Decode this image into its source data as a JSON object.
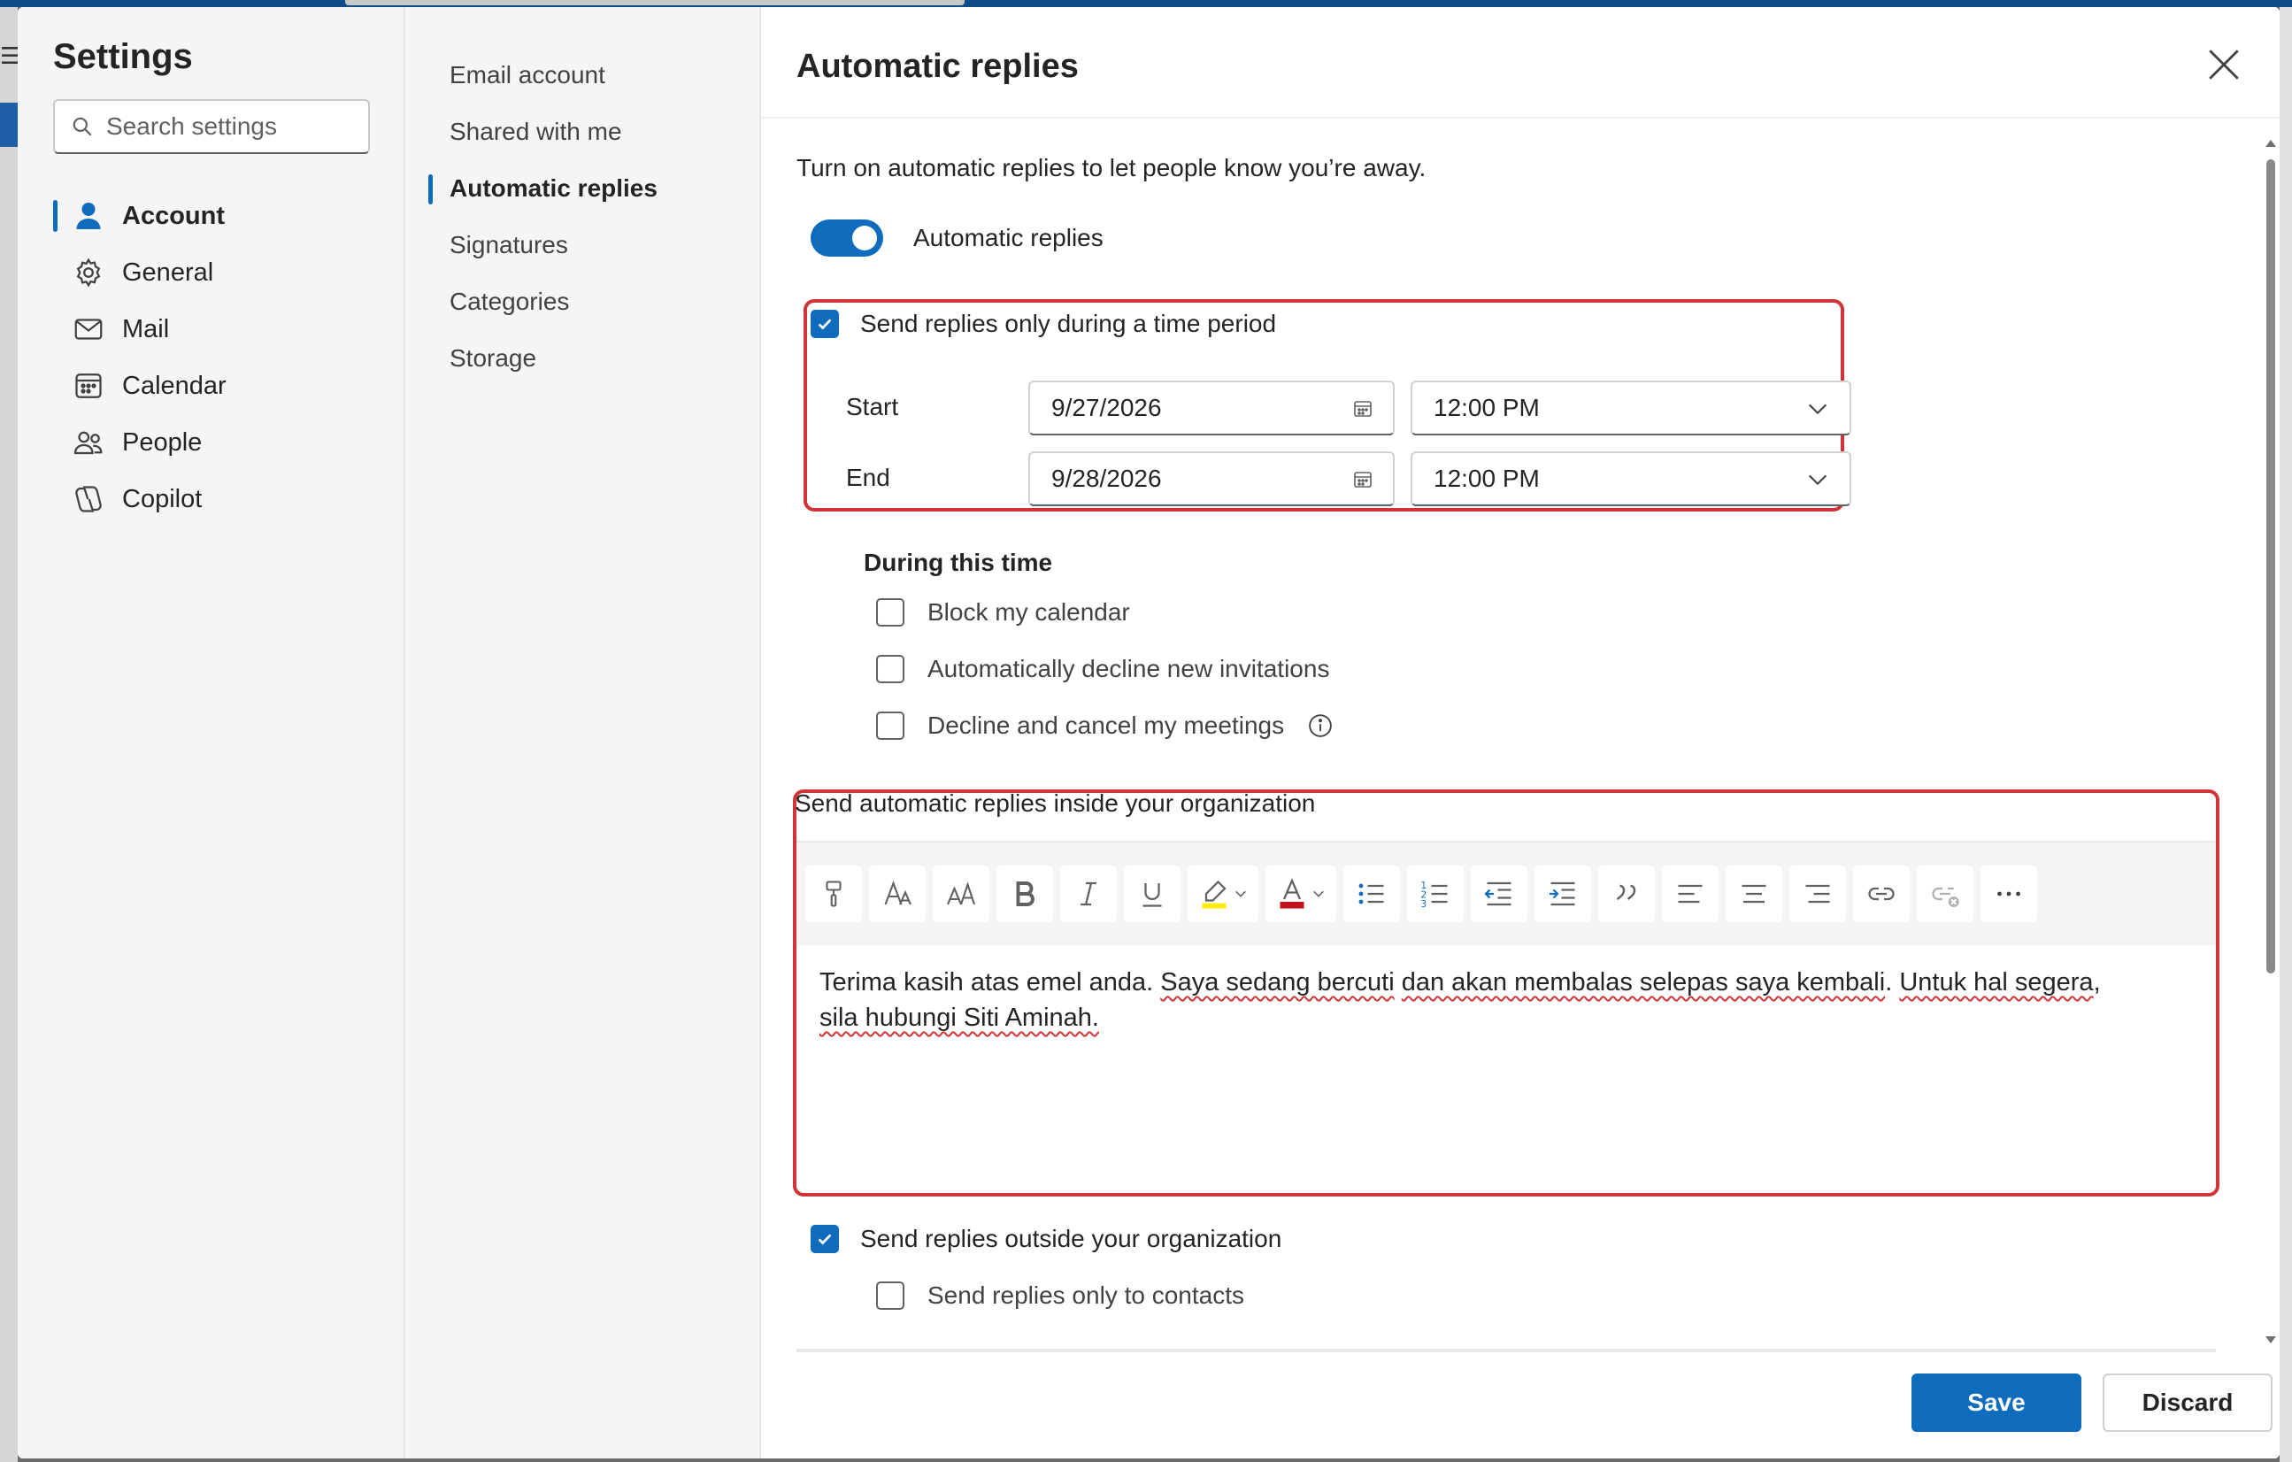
{
  "sidebar": {
    "title": "Settings",
    "search_placeholder": "Search settings",
    "items": [
      {
        "label": "Account",
        "icon": "person-icon",
        "active": true
      },
      {
        "label": "General",
        "icon": "gear-icon"
      },
      {
        "label": "Mail",
        "icon": "mail-icon"
      },
      {
        "label": "Calendar",
        "icon": "calendar-icon"
      },
      {
        "label": "People",
        "icon": "people-icon"
      },
      {
        "label": "Copilot",
        "icon": "copilot-icon"
      }
    ]
  },
  "subnav": {
    "items": [
      {
        "label": "Email account"
      },
      {
        "label": "Shared with me"
      },
      {
        "label": "Automatic replies",
        "active": true
      },
      {
        "label": "Signatures"
      },
      {
        "label": "Categories"
      },
      {
        "label": "Storage"
      }
    ]
  },
  "main": {
    "title": "Automatic replies",
    "intro": "Turn on automatic replies to let people know you’re away.",
    "toggle_label": "Automatic replies",
    "toggle_on": true,
    "time_period_label": "Send replies only during a time period",
    "time_period_checked": true,
    "start_label": "Start",
    "start_date": "9/27/2026",
    "start_time": "12:00 PM",
    "end_label": "End",
    "end_date": "9/28/2026",
    "end_time": "12:00 PM",
    "during_title": "During this time",
    "options": [
      {
        "label": "Block my calendar",
        "checked": false
      },
      {
        "label": "Automatically decline new invitations",
        "checked": false
      },
      {
        "label": "Decline and cancel my meetings",
        "checked": false
      }
    ],
    "inside_label": "Send automatic replies inside your organization",
    "message": {
      "line1_parts": [
        "Terima kasih atas emel anda. ",
        "Saya sedang bercuti",
        " ",
        "dan akan membalas selepas saya kembali",
        ". ",
        "Untuk hal segera",
        ","
      ],
      "line2": "sila hubungi Siti Aminah."
    },
    "outside_label": "Send replies outside your organization",
    "outside_checked": true,
    "contacts_label": "Send replies only to contacts",
    "contacts_checked": false
  },
  "footer": {
    "save_label": "Save",
    "discard_label": "Discard"
  },
  "colors": {
    "accent": "#0f6cbd",
    "highlight": "#d13438",
    "highlighter_yellow": "#ffee00",
    "font_color_red": "#c50f1f"
  }
}
